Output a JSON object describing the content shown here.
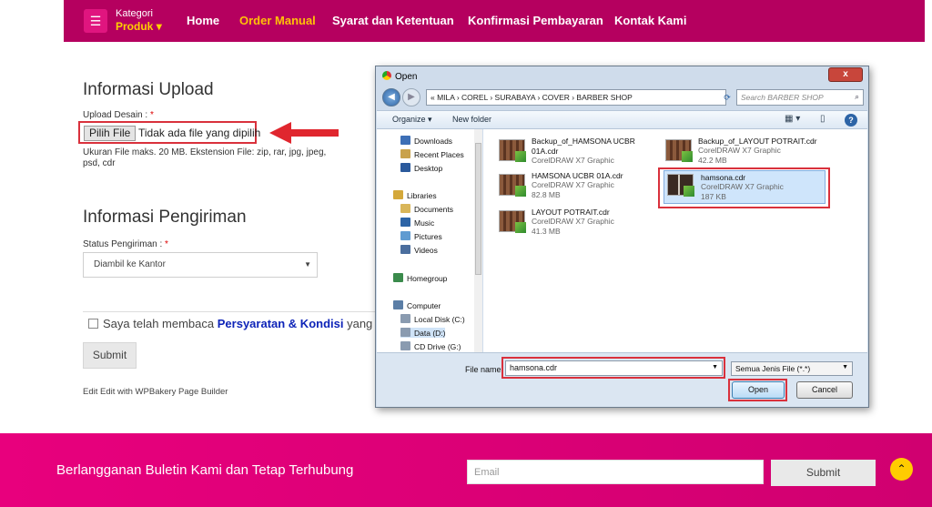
{
  "nav": {
    "category_label": "Kategori",
    "category_value": "Produk",
    "items": [
      {
        "label": "Home",
        "active": false
      },
      {
        "label": "Order Manual",
        "active": true
      },
      {
        "label": "Syarat dan Ketentuan",
        "active": false
      },
      {
        "label": "Konfirmasi Pembayaran",
        "active": false
      },
      {
        "label": "Kontak Kami",
        "active": false
      }
    ],
    "colors": {
      "bar": "#b5005f",
      "active": "#ffc107"
    }
  },
  "upload": {
    "heading": "Informasi Upload",
    "field_label": "Upload Desain :",
    "required_mark": "*",
    "choose_button": "Pilih File",
    "no_file_text": "Tidak ada file yang dipilih",
    "help_line1": "Ukuran File maks. 20 MB. Ekstension File: zip, rar, jpg, jpeg,",
    "help_line2": "psd, cdr"
  },
  "shipping": {
    "heading": "Informasi Pengiriman",
    "status_label": "Status Pengiriman :",
    "required_mark": "*",
    "status_value": "Diambil ke Kantor"
  },
  "agreement": {
    "prefix": "Saya telah membaca",
    "link": "Persyaratan & Kondisi",
    "suffix": "yang b"
  },
  "form": {
    "submit_label": "Submit",
    "edit_text": "Edit Edit with WPBakery Page Builder"
  },
  "footer": {
    "title": "Berlangganan Buletin Kami dan Tetap Terhubung",
    "email_placeholder": "Email",
    "submit_label": "Submit",
    "totop_icon": "chevron-up-icon"
  },
  "dialog": {
    "title": "Open",
    "close_label": "x",
    "path": "« MILA › COREL › SURABAYA › COVER › BARBER SHOP",
    "search_placeholder": "Search BARBER SHOP",
    "organize": "Organize ▾",
    "new_folder": "New folder",
    "nav_items": [
      {
        "label": "Downloads",
        "color": "#3d6fb6"
      },
      {
        "label": "Recent Places",
        "color": "#c9a24b"
      },
      {
        "label": "Desktop",
        "color": "#2b5a9c"
      },
      {
        "label": "Libraries",
        "color": "#d4a83a"
      },
      {
        "label": "Documents",
        "color": "#d9b659"
      },
      {
        "label": "Music",
        "color": "#2d64a6"
      },
      {
        "label": "Pictures",
        "color": "#5f9bd1"
      },
      {
        "label": "Videos",
        "color": "#4b6e9e"
      },
      {
        "label": "Homegroup",
        "color": "#3b8b4c"
      },
      {
        "label": "Computer",
        "color": "#5b7ea6"
      },
      {
        "label": "Local Disk (C:)",
        "color": "#8a9bb0"
      },
      {
        "label": "Data (D:)",
        "color": "#8a9bb0"
      },
      {
        "label": "CD Drive (G:)",
        "color": "#8a9bb0"
      }
    ],
    "files": [
      {
        "name_line1": "Backup_of_HAMSONA UCBR",
        "name_line2": "01A.cdr",
        "type": "CorelDRAW X7 Graphic",
        "size": ""
      },
      {
        "name_line1": "Backup_of_LAYOUT POTRAIT.cdr",
        "name_line2": "",
        "type": "CorelDRAW X7 Graphic",
        "size": "42.2 MB"
      },
      {
        "name_line1": "HAMSONA UCBR 01A.cdr",
        "name_line2": "",
        "type": "CorelDRAW X7 Graphic",
        "size": "82.8 MB"
      },
      {
        "name_line1": "hamsona.cdr",
        "name_line2": "",
        "type": "CorelDRAW X7 Graphic",
        "size": "187 KB"
      },
      {
        "name_line1": "LAYOUT POTRAIT.cdr",
        "name_line2": "",
        "type": "CorelDRAW X7 Graphic",
        "size": "41.3 MB"
      }
    ],
    "filename_label": "File name:",
    "filename_value": "hamsona.cdr",
    "filetype_value": "Semua Jenis File (*.*)",
    "open_label": "Open",
    "cancel_label": "Cancel"
  }
}
